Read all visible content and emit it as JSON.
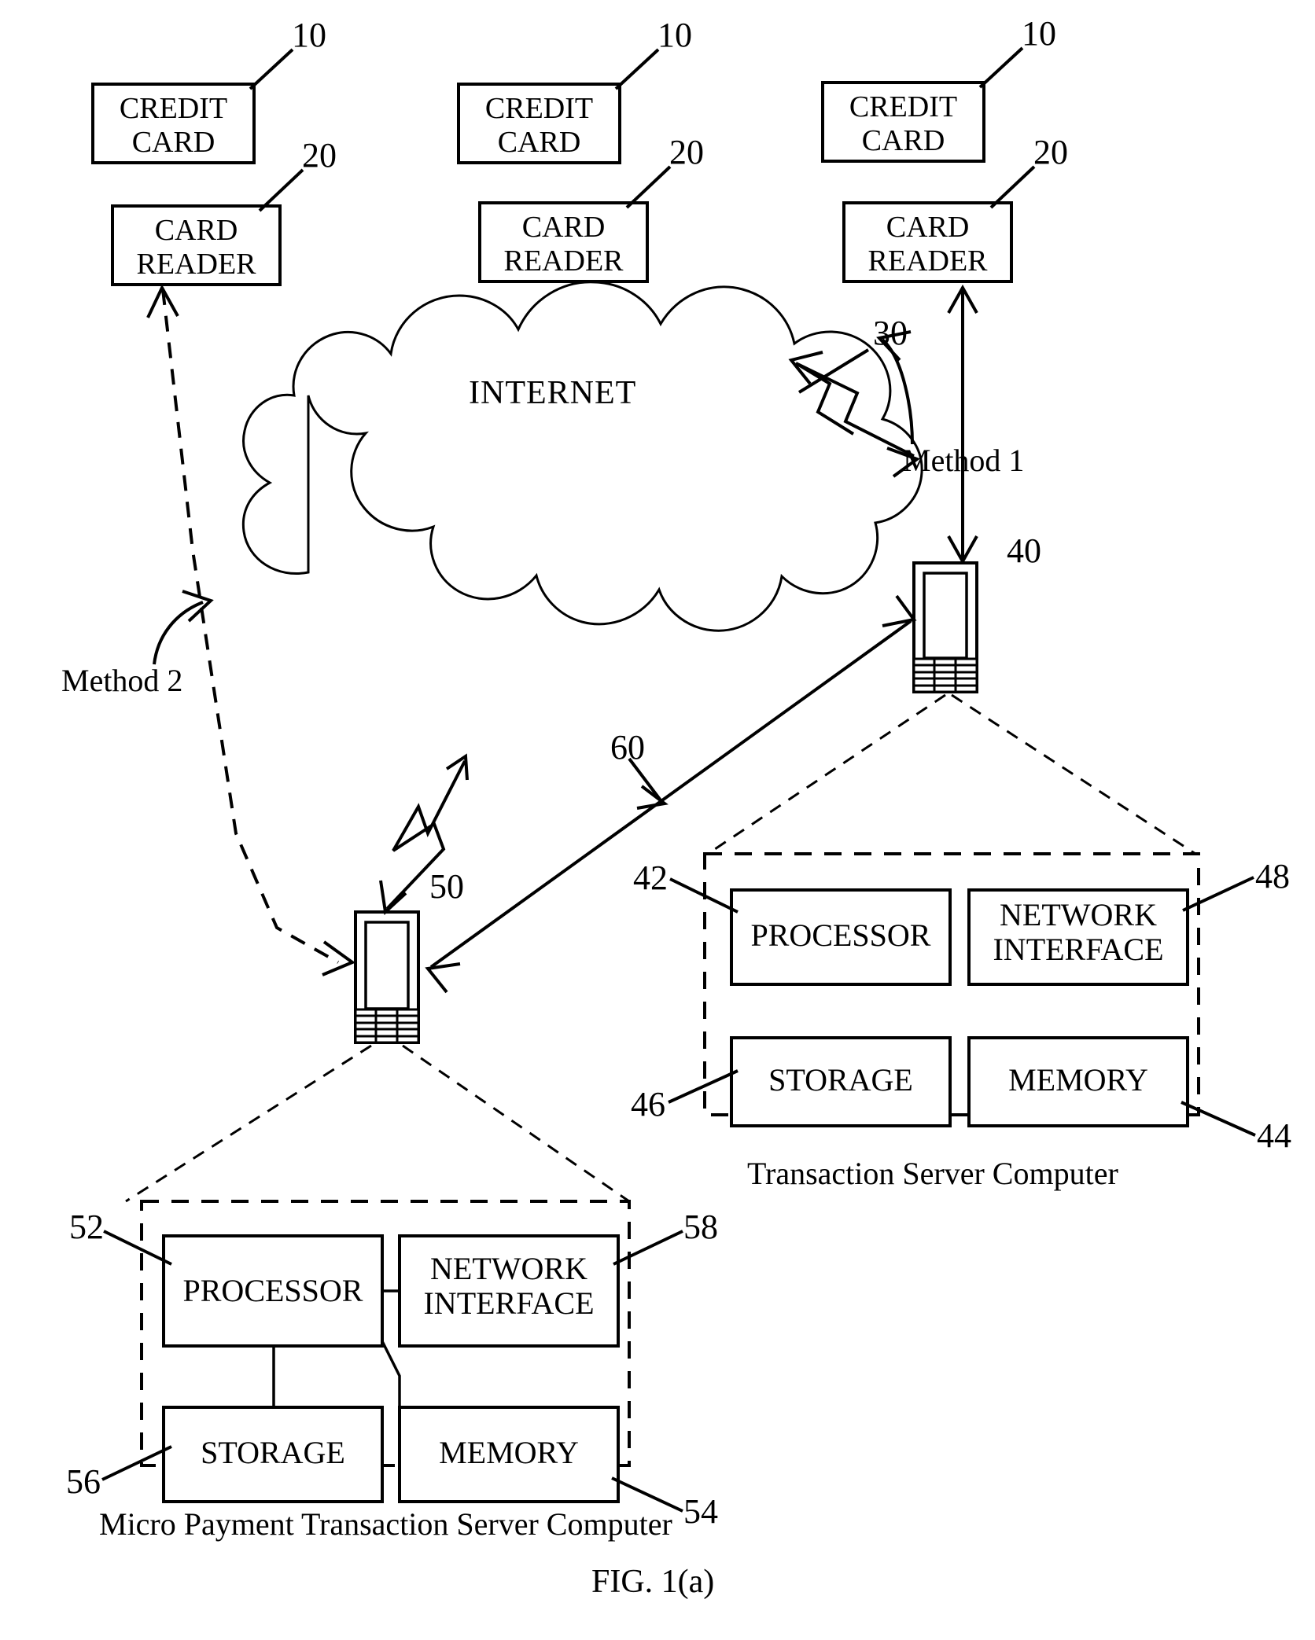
{
  "figure": {
    "label": "FIG. 1(a)",
    "network_label": "INTERNET"
  },
  "credit_cards": [
    {
      "ref": "10",
      "text": "CREDIT\nCARD"
    },
    {
      "ref": "10",
      "text": "CREDIT\nCARD"
    },
    {
      "ref": "10",
      "text": "CREDIT\nCARD"
    }
  ],
  "card_readers": [
    {
      "ref": "20",
      "text": "CARD\nREADER"
    },
    {
      "ref": "20",
      "text": "CARD\nREADER"
    },
    {
      "ref": "20",
      "text": "CARD\nREADER"
    }
  ],
  "network": {
    "ref": "30",
    "label": "INTERNET"
  },
  "methods": {
    "method1": "Method 1",
    "method2": "Method 2"
  },
  "devices": {
    "phone_right": {
      "ref": "40"
    },
    "phone_left": {
      "ref": "50"
    },
    "link": {
      "ref": "60"
    }
  },
  "transaction_server": {
    "caption": "Transaction Server Computer",
    "components": [
      {
        "ref": "42",
        "label": "PROCESSOR"
      },
      {
        "ref": "48",
        "label": "NETWORK\nINTERFACE"
      },
      {
        "ref": "46",
        "label": "STORAGE"
      },
      {
        "ref": "44",
        "label": "MEMORY"
      }
    ]
  },
  "micro_payment_server": {
    "caption": "Micro Payment Transaction Server Computer",
    "components": [
      {
        "ref": "52",
        "label": "PROCESSOR"
      },
      {
        "ref": "58",
        "label": "NETWORK\nINTERFACE"
      },
      {
        "ref": "56",
        "label": "STORAGE"
      },
      {
        "ref": "54",
        "label": "MEMORY"
      }
    ]
  }
}
